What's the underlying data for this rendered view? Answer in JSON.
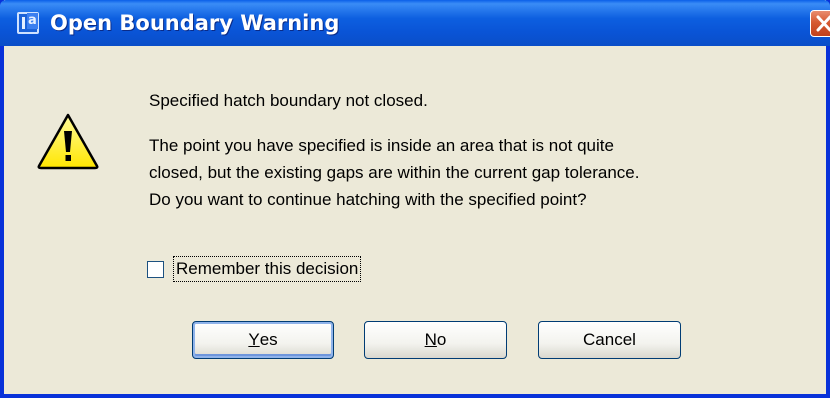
{
  "window": {
    "title": "Open Boundary Warning",
    "app_icon": "app-icon",
    "close_icon": "close-icon"
  },
  "message": {
    "icon": "warning-icon",
    "heading": "Specified hatch boundary not closed.",
    "body_lines": [
      "The point you have specified is inside an area that is not quite",
      "closed, but the existing gaps are within the current gap tolerance.",
      "Do you want to continue hatching with the specified point?"
    ]
  },
  "checkbox": {
    "label": "Remember this decision",
    "checked": false
  },
  "buttons": {
    "yes": {
      "mnemonic": "Y",
      "rest": "es"
    },
    "no": {
      "mnemonic": "N",
      "rest": "o"
    },
    "cancel": {
      "label": "Cancel"
    }
  },
  "colors": {
    "titlebar": "#0a54d6",
    "close_button": "#d65a32",
    "dialog_bg": "#ece9d8",
    "warning_yellow": "#fff200"
  }
}
